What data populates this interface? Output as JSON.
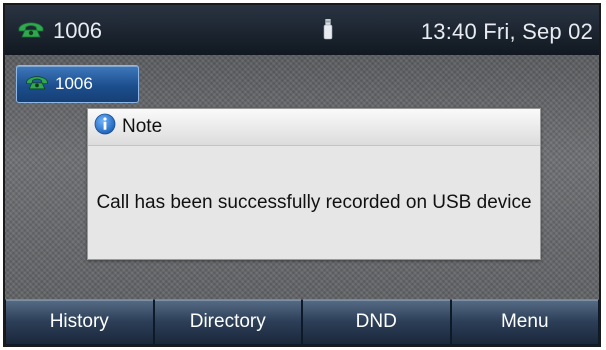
{
  "statusbar": {
    "line_number": "1006",
    "datetime": "13:40 Fri, Sep 02",
    "usb_icon": "usb-icon"
  },
  "line_key": {
    "label": "1006",
    "icon": "handset-icon"
  },
  "dialog": {
    "title": "Note",
    "title_icon": "info-icon",
    "message": "Call has been successfully recorded on USB device"
  },
  "softkeys": [
    "History",
    "Directory",
    "DND",
    "Menu"
  ],
  "colors": {
    "handset_green": "#2fa84f",
    "info_blue": "#2b7fd4",
    "softkey_blue": "#2c3e57"
  }
}
